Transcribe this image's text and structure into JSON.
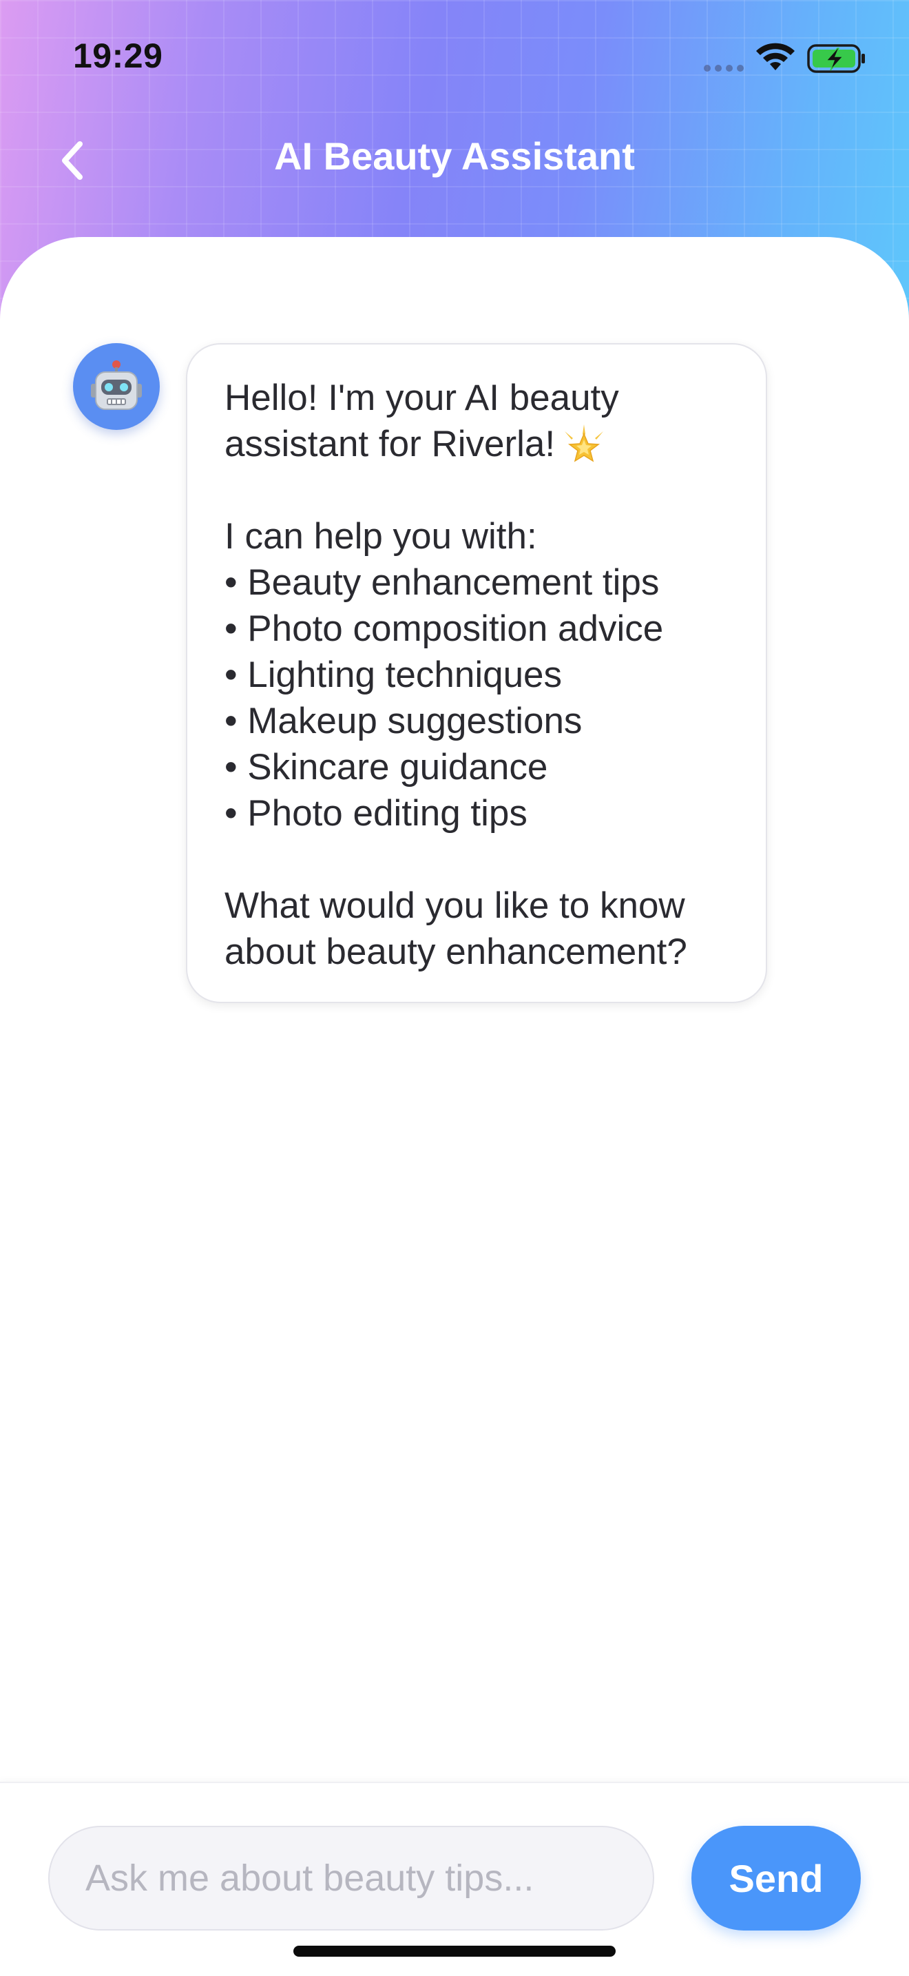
{
  "status_bar": {
    "time": "19:29"
  },
  "header": {
    "title": "AI Beauty Assistant",
    "gradient_colors": [
      "#dc9cf2",
      "#8584f8",
      "#5ec8fb"
    ]
  },
  "chat": {
    "messages": [
      {
        "sender": "assistant",
        "avatar_icon": "robot-icon",
        "text_before_icon": "Hello! I'm your AI beauty\nassistant for Riverla!",
        "inline_icon": "glowing-star-icon",
        "text_after_icon": "\n\nI can help you with:\n• Beauty enhancement tips\n• Photo composition advice\n• Lighting techniques\n• Makeup suggestions\n• Skincare guidance\n• Photo editing tips\n\nWhat would you like to know\nabout beauty enhancement?"
      }
    ]
  },
  "composer": {
    "placeholder": "Ask me about beauty tips...",
    "value": "",
    "send_label": "Send",
    "accent_color": "#4a96fa"
  }
}
